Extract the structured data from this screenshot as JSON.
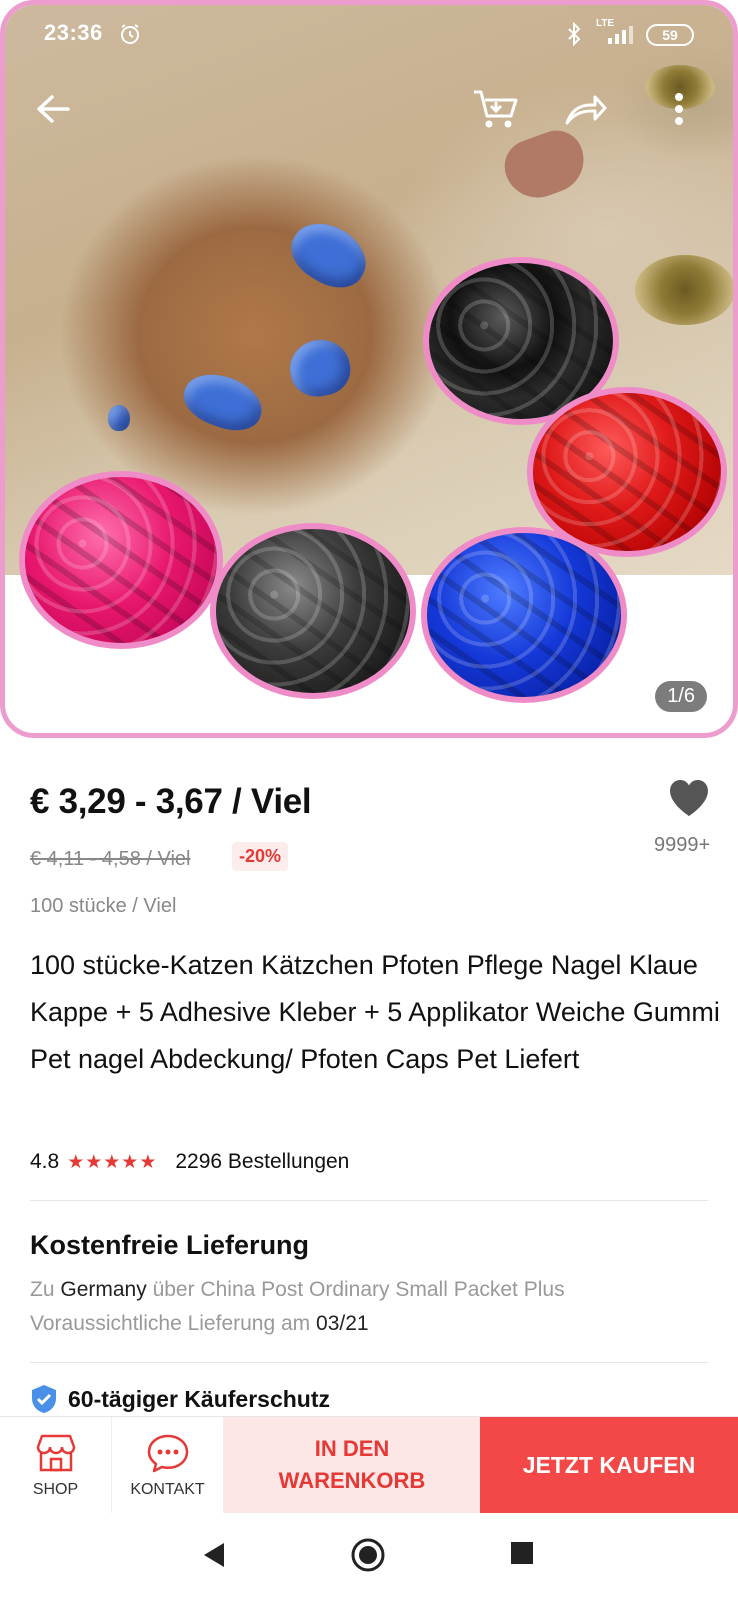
{
  "status_bar": {
    "time": "23:36",
    "network": "LTE",
    "battery": "59"
  },
  "gallery": {
    "page_indicator": "1/6",
    "colors": [
      "#3f6fd6",
      "#111111",
      "#e01a1a",
      "#e8176e",
      "#3c3c3c",
      "#1438d8"
    ]
  },
  "product": {
    "price": "€ 3,29 - 3,67 / Viel",
    "old_price": "€ 4,11 - 4,58 / Viel",
    "discount": "-20%",
    "unit": "100 stücke / Viel",
    "wishlist_count": "9999+",
    "title": "100 stücke-Katzen Kätzchen Pfoten Pflege Nagel Klaue Kappe + 5 Adhesive Kleber + 5 Applikator Weiche Gummi Pet nagel Abdeckung/ Pfoten Caps Pet Liefert",
    "rating": "4.8",
    "stars": "★★★★★",
    "orders": "2296 Bestellungen"
  },
  "shipping": {
    "title": "Kostenfreie Lieferung",
    "to_prefix": "Zu",
    "country": "Germany",
    "method": "über China Post Ordinary Small Packet Plus",
    "eta_prefix": "Voraussichtliche Lieferung am",
    "eta_date": "03/21"
  },
  "protection": {
    "label": "60-tägiger Käuferschutz"
  },
  "bottom_bar": {
    "shop_label": "SHOP",
    "contact_label": "KONTAKT",
    "cart_label": "IN DEN WARENKORB",
    "buy_label": "JETZT KAUFEN"
  },
  "theme": {
    "accent_red": "#f44748",
    "cart_bg": "#fde6e6",
    "frame_pink": "#ec9ccd"
  }
}
